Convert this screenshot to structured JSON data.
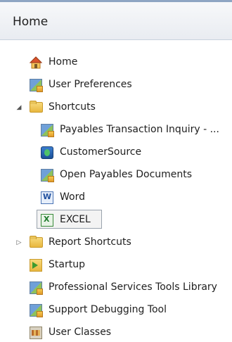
{
  "header": {
    "title": "Home"
  },
  "tree": [
    {
      "label": "Home",
      "icon": "home-icon"
    },
    {
      "label": "User Preferences",
      "icon": "window-app-icon"
    },
    {
      "label": "Shortcuts",
      "icon": "folder-icon",
      "expanded": true
    },
    {
      "label": "Payables Transaction Inquiry - ...",
      "icon": "window-app-icon"
    },
    {
      "label": "CustomerSource",
      "icon": "globe-link-icon"
    },
    {
      "label": "Open Payables Documents",
      "icon": "window-app-icon"
    },
    {
      "label": "Word",
      "icon": "word-icon"
    },
    {
      "label": "EXCEL",
      "icon": "excel-icon",
      "selected": true
    },
    {
      "label": "Report Shortcuts",
      "icon": "folder-icon",
      "expanded": false
    },
    {
      "label": "Startup",
      "icon": "startup-folder-icon"
    },
    {
      "label": "Professional Services Tools Library",
      "icon": "window-app-icon"
    },
    {
      "label": "Support Debugging Tool",
      "icon": "window-app-icon"
    },
    {
      "label": "User Classes",
      "icon": "user-classes-icon"
    }
  ],
  "colors": {
    "header_border": "#8ea5c3",
    "selection_border": "#9aa3ad"
  }
}
